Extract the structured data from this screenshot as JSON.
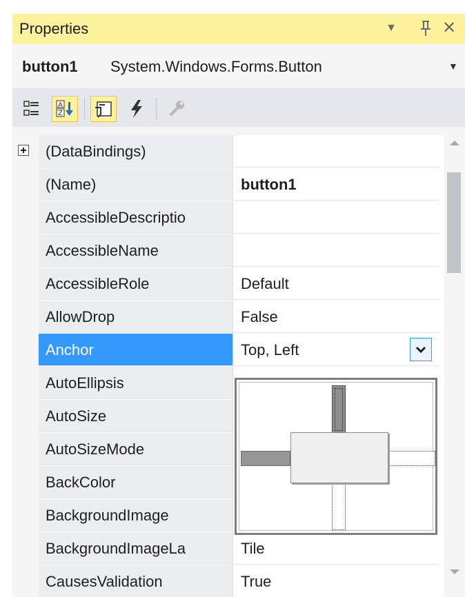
{
  "window": {
    "title": "Properties",
    "dropdown_icon": "triangle-down-icon",
    "pin_icon": "pin-icon",
    "close_icon": "close-icon",
    "dropdown_glyph": "▼",
    "pin_glyph": "🖈",
    "close_glyph": "✕"
  },
  "object_selector": {
    "name": "button1",
    "type": "System.Windows.Forms.Button",
    "arrow": "▼"
  },
  "toolbar": {
    "buttons": [
      "categorized-icon",
      "alphabetical-icon",
      "properties-icon",
      "events-icon",
      "property-pages-icon"
    ],
    "active": [
      "alphabetical-icon",
      "properties-icon"
    ]
  },
  "grid": {
    "rows": [
      {
        "name": "(DataBindings)",
        "value": ""
      },
      {
        "name": "(Name)",
        "value": "button1"
      },
      {
        "name": "AccessibleDescriptio",
        "value": ""
      },
      {
        "name": "AccessibleName",
        "value": ""
      },
      {
        "name": "AccessibleRole",
        "value": "Default"
      },
      {
        "name": "AllowDrop",
        "value": "False"
      },
      {
        "name": "Anchor",
        "value": "Top, Left"
      },
      {
        "name": "AutoEllipsis",
        "value": ""
      },
      {
        "name": "AutoSize",
        "value": ""
      },
      {
        "name": "AutoSizeMode",
        "value": ""
      },
      {
        "name": "BackColor",
        "value": ""
      },
      {
        "name": "BackgroundImage",
        "value": ""
      },
      {
        "name": "BackgroundImageLa",
        "value": "Tile"
      },
      {
        "name": "CausesValidation",
        "value": "True"
      }
    ],
    "selected": "Anchor"
  },
  "anchor_editor": {
    "top": true,
    "left": true,
    "right": false,
    "bottom": false
  },
  "colors": {
    "title_bar": "#fff29d",
    "selection": "#3399ff"
  }
}
